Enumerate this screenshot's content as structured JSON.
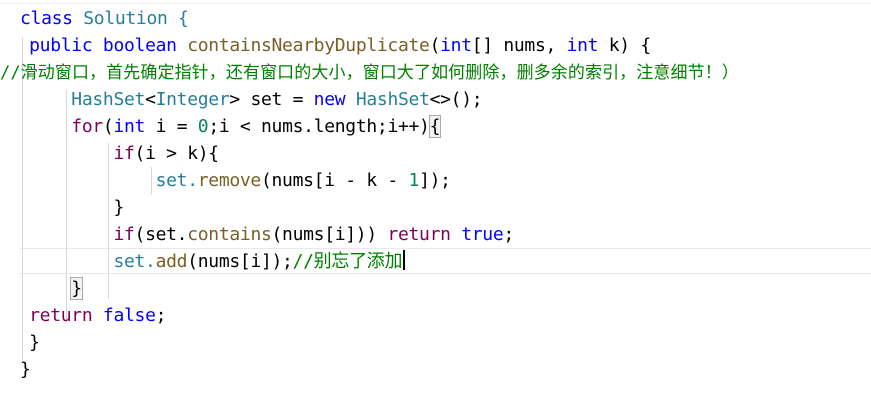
{
  "editor": {
    "lines": [
      {
        "tokens": [
          {
            "text": "class",
            "kind": "kw"
          },
          {
            "text": " Solution {",
            "kind": "type"
          }
        ]
      },
      {
        "tokens": [
          {
            "text": "    public",
            "kind": "kw"
          },
          {
            "text": " ",
            "kind": "plain"
          },
          {
            "text": "boolean",
            "kind": "kw"
          },
          {
            "text": " containsNearbyDuplicate",
            "kind": "method"
          },
          {
            "text": "(",
            "kind": "plain"
          },
          {
            "text": "int",
            "kind": "kw"
          },
          {
            "text": "[] nums, ",
            "kind": "plain"
          },
          {
            "text": "int",
            "kind": "kw"
          },
          {
            "text": " k) {",
            "kind": "plain"
          }
        ]
      },
      {
        "tokens": [
          {
            "text": "//滑动窗口，首先确定指针，还有窗口的大小，窗口大了如何删除，删多余的索引，注意细节！）",
            "kind": "comment"
          }
        ]
      },
      {
        "tokens": [
          {
            "text": "        HashSet",
            "kind": "type"
          },
          {
            "text": "<",
            "kind": "plain"
          },
          {
            "text": "Integer",
            "kind": "type"
          },
          {
            "text": "> set = ",
            "kind": "plain"
          },
          {
            "text": "new",
            "kind": "kw"
          },
          {
            "text": " ",
            "kind": "plain"
          },
          {
            "text": "HashSet",
            "kind": "type"
          },
          {
            "text": "<>();",
            "kind": "plain"
          }
        ]
      },
      {
        "tokens": [
          {
            "text": "        for",
            "kind": "kwp"
          },
          {
            "text": "(",
            "kind": "plain"
          },
          {
            "text": "int",
            "kind": "kw"
          },
          {
            "text": " i = ",
            "kind": "plain"
          },
          {
            "text": "0",
            "kind": "num"
          },
          {
            "text": ";i < nums.length;i++)",
            "kind": "plain"
          },
          {
            "text": "{",
            "kind": "brace"
          }
        ]
      },
      {
        "tokens": [
          {
            "text": "            if",
            "kind": "kwp"
          },
          {
            "text": "(i > k){",
            "kind": "plain"
          }
        ]
      },
      {
        "tokens": [
          {
            "text": "                set.",
            "kind": "type"
          },
          {
            "text": "remove",
            "kind": "method"
          },
          {
            "text": "(nums[i - k - ",
            "kind": "plain"
          },
          {
            "text": "1",
            "kind": "num"
          },
          {
            "text": "]);",
            "kind": "plain"
          }
        ]
      },
      {
        "tokens": [
          {
            "text": "            }",
            "kind": "plain"
          }
        ]
      },
      {
        "tokens": [
          {
            "text": "            if",
            "kind": "kwp"
          },
          {
            "text": "(set.",
            "kind": "plain"
          },
          {
            "text": "contains",
            "kind": "method"
          },
          {
            "text": "(nums[i])) ",
            "kind": "plain"
          },
          {
            "text": "return",
            "kind": "kwp"
          },
          {
            "text": " ",
            "kind": "plain"
          },
          {
            "text": "true",
            "kind": "bool"
          },
          {
            "text": ";",
            "kind": "plain"
          }
        ]
      },
      {
        "tokens": [
          {
            "text": "            set.",
            "kind": "type"
          },
          {
            "text": "add",
            "kind": "method"
          },
          {
            "text": "(nums[i]);",
            "kind": "plain"
          },
          {
            "text": "//别忘了添加",
            "kind": "comment"
          }
        ]
      },
      {
        "tokens": [
          {
            "text": "        ",
            "kind": "plain"
          },
          {
            "text": "}",
            "kind": "brace"
          }
        ]
      },
      {
        "tokens": [
          {
            "text": "    return",
            "kind": "kwp"
          },
          {
            "text": " ",
            "kind": "plain"
          },
          {
            "text": "false",
            "kind": "bool"
          },
          {
            "text": ";",
            "kind": "plain"
          }
        ]
      },
      {
        "tokens": [
          {
            "text": "    }",
            "kind": "plain"
          }
        ]
      },
      {
        "tokens": [
          {
            "text": "}",
            "kind": "plain"
          }
        ]
      }
    ]
  },
  "colors": {
    "keyword": "#0000ff",
    "control": "#7f0055",
    "type": "#267f99",
    "method": "#795e26",
    "number": "#098658",
    "comment": "#008000",
    "text": "#000000",
    "background": "#ffffff"
  }
}
